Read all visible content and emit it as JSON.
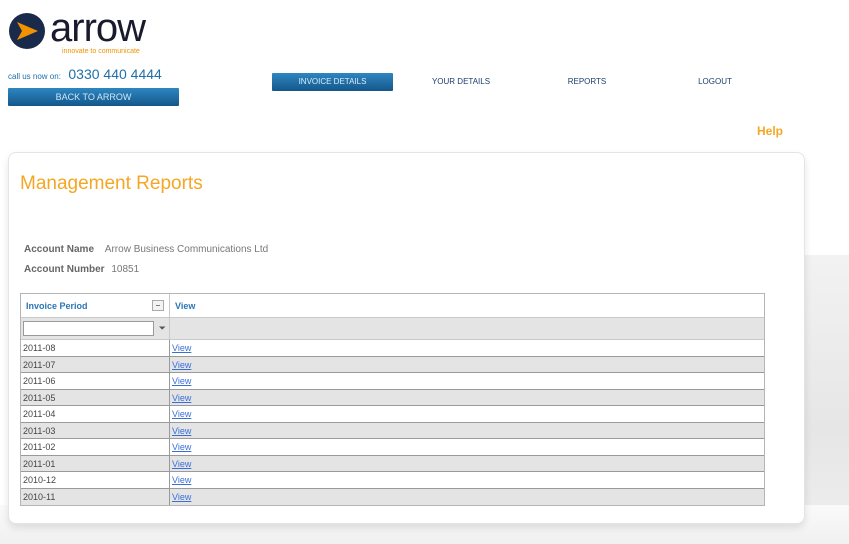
{
  "brand": {
    "name": "arrow",
    "tagline": "innovate to communicate",
    "orange": "#f39200",
    "blue": "#1f6fa8"
  },
  "contact": {
    "label": "call us now on:",
    "phone": "0330 440 4444"
  },
  "back_button": "BACK TO ARROW",
  "nav": {
    "items": [
      {
        "label": "INVOICE DETAILS",
        "active": true
      },
      {
        "label": "YOUR DETAILS",
        "active": false
      },
      {
        "label": "REPORTS",
        "active": false
      },
      {
        "label": "LOGOUT",
        "active": false
      }
    ]
  },
  "help": "Help",
  "page": {
    "title": "Management Reports",
    "account_name_label": "Account Name",
    "account_name": "Arrow Business Communications Ltd",
    "account_number_label": "Account Number",
    "account_number": "10851"
  },
  "grid": {
    "columns": [
      "Invoice Period",
      "View"
    ],
    "filter_value": "",
    "rows": [
      {
        "period": "2011-08",
        "link": "View"
      },
      {
        "period": "2011-07",
        "link": "View"
      },
      {
        "period": "2011-06",
        "link": "View"
      },
      {
        "period": "2011-05",
        "link": "View"
      },
      {
        "period": "2011-04",
        "link": "View"
      },
      {
        "period": "2011-03",
        "link": "View"
      },
      {
        "period": "2011-02",
        "link": "View"
      },
      {
        "period": "2011-01",
        "link": "View"
      },
      {
        "period": "2010-12",
        "link": "View"
      },
      {
        "period": "2010-11",
        "link": "View"
      }
    ]
  }
}
